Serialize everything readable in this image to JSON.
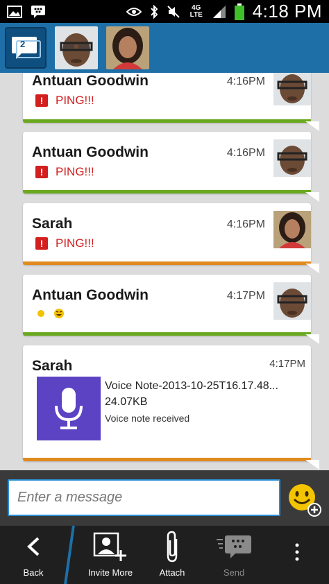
{
  "status_bar": {
    "time": "4:18 PM",
    "network_label": "4G LTE",
    "icons": [
      "gallery-icon",
      "bbm-notification-icon",
      "eye-icon",
      "bluetooth-icon",
      "mute-icon",
      "signal-icon",
      "battery-icon"
    ],
    "battery_color": "#3fbf2a"
  },
  "header": {
    "chat_count": "2",
    "contacts": [
      "Antuan Goodwin",
      "Sarah"
    ],
    "background": "#1e6fa8"
  },
  "messages": [
    {
      "sender": "Antuan Goodwin",
      "time": "4:16PM",
      "text": "PING!!!",
      "type": "ping",
      "accent": "#6aa91f"
    },
    {
      "sender": "Antuan Goodwin",
      "time": "4:16PM",
      "text": "PING!!!",
      "type": "ping",
      "accent": "#6aa91f"
    },
    {
      "sender": "Sarah",
      "time": "4:16PM",
      "text": "PING!!!",
      "type": "ping",
      "accent": "#e08a1e"
    },
    {
      "sender": "Antuan Goodwin",
      "time": "4:17PM",
      "text": "",
      "type": "emoji",
      "accent": "#6aa91f"
    },
    {
      "sender": "Sarah",
      "time": "4:17PM",
      "type": "voice",
      "accent": "#e08a1e",
      "voice": {
        "name": "Voice Note-2013-10-25T16.17.48...",
        "size": "24.07KB",
        "status": "Voice note received"
      }
    }
  ],
  "compose": {
    "placeholder": "Enter a message"
  },
  "actions": {
    "back": "Back",
    "invite": "Invite More",
    "attach": "Attach",
    "send": "Send"
  }
}
